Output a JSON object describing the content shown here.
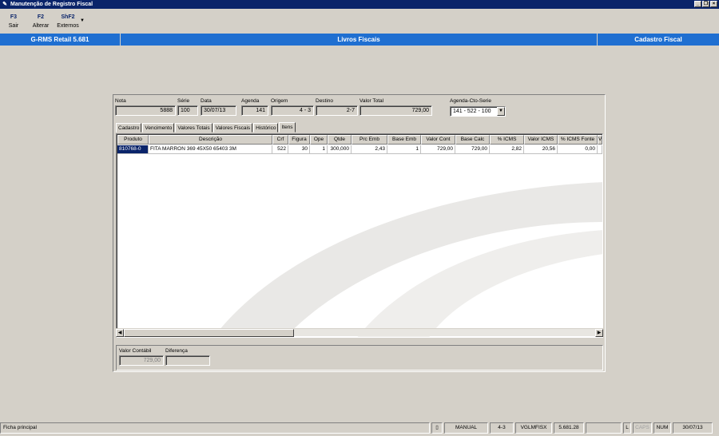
{
  "window": {
    "title": "Manutenção de Registro Fiscal"
  },
  "toolbar": [
    {
      "key": "F3",
      "label": "Sair"
    },
    {
      "key": "F2",
      "label": "Alterar"
    },
    {
      "key": "ShF2",
      "label": "Externos"
    }
  ],
  "band": {
    "left": "G-RMS Retail 5.681",
    "center": "Livros Fiscais",
    "right": "Cadastro Fiscal"
  },
  "header": {
    "nota": {
      "label": "Nota",
      "value": "5888"
    },
    "serie": {
      "label": "Série",
      "value": "100"
    },
    "data": {
      "label": "Data",
      "value": "30/07/13"
    },
    "agenda": {
      "label": "Agenda",
      "value": "141"
    },
    "origem": {
      "label": "Origem",
      "value": "4 - 3"
    },
    "destino": {
      "label": "Destino",
      "value": "2-7"
    },
    "valor_total": {
      "label": "Valor Total",
      "value": "729,00"
    },
    "agenda_cto_serie": {
      "label": "Agenda-Cto-Serie",
      "value": "141 - 522 - 100"
    }
  },
  "tabs": [
    "Cadastro",
    "Vencimento",
    "Valores Totais",
    "Valores Fiscais",
    "Histórico",
    "Itens"
  ],
  "active_tab": "Itens",
  "grid": {
    "columns": [
      "Produto",
      "Descrição",
      "Crf",
      "Figura",
      "Ope",
      "Qtde",
      "Prc Emb",
      "Base Emb",
      "Valor Cont",
      "Base Calc",
      "% ICMS",
      "Valor ICMS",
      "% ICMS Fonte",
      "V"
    ],
    "rows": [
      [
        "810768-0",
        "FITA MARRON 369 45X50 65403 3M",
        "522",
        "30",
        "1",
        "300,000",
        "2,43",
        "1",
        "729,00",
        "729,00",
        "2,82",
        "20,56",
        "0,00",
        ""
      ]
    ]
  },
  "totals": {
    "valor_contabil": {
      "label": "Valor Contábil",
      "value": "729,00"
    },
    "diferenca": {
      "label": "Diferença",
      "value": ""
    }
  },
  "status": {
    "message": "Ficha principal",
    "mode": "MANUAL",
    "loja": "4-3",
    "user": "VGLMFISX",
    "version": "5.681.28",
    "blank": "",
    "l": "L",
    "caps": "CAPS",
    "num": "NUM",
    "date": "30/07/13"
  },
  "colors": {
    "title_bar": "#0a246a",
    "band": "#1f6fd1",
    "face": "#d4d0c8",
    "selection": "#0a246a"
  }
}
